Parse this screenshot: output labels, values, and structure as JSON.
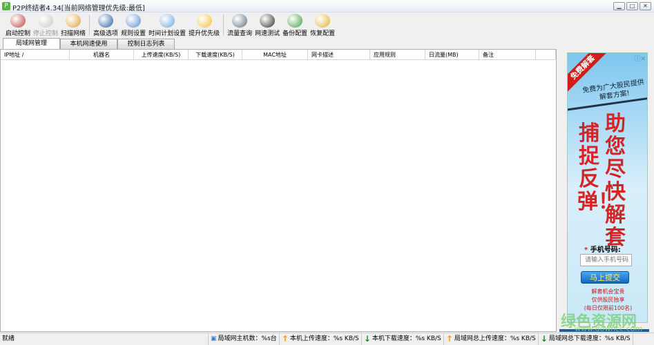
{
  "window": {
    "title": "P2P终结者4.34[当前网络管理优先级:最低]",
    "buttons": [
      "minimize",
      "maximize",
      "close"
    ]
  },
  "toolbar": [
    {
      "label": "启动控制",
      "icon": "rocket-icon",
      "color": "#c04040",
      "enabled": true
    },
    {
      "label": "停止控制",
      "icon": "stop-rocket-icon",
      "color": "#c8c8c8",
      "enabled": false
    },
    {
      "label": "扫描网络",
      "icon": "magnifier-icon",
      "color": "#e0a030",
      "enabled": true
    },
    {
      "label": "高级选项",
      "icon": "globe-gear-icon",
      "color": "#2a5fa0",
      "enabled": true
    },
    {
      "label": "规则设置",
      "icon": "window-key-icon",
      "color": "#5a8fd0",
      "enabled": true
    },
    {
      "label": "时间计划设置",
      "icon": "clock-icon",
      "color": "#6aa7e0",
      "enabled": true
    },
    {
      "label": "提升优先级",
      "icon": "medal-icon",
      "color": "#f0c030",
      "enabled": true
    },
    {
      "label": "流量查询",
      "icon": "database-icon",
      "color": "#607080",
      "enabled": true
    },
    {
      "label": "网速测试",
      "icon": "speedometer-icon",
      "color": "#303030",
      "enabled": true
    },
    {
      "label": "备份配置",
      "icon": "box-down-icon",
      "color": "#40a040",
      "enabled": true
    },
    {
      "label": "恢复配置",
      "icon": "box-refresh-icon",
      "color": "#e0b030",
      "enabled": true
    }
  ],
  "tabs": [
    {
      "label": "局域网管理",
      "active": true
    },
    {
      "label": "本机网速使用",
      "active": false
    },
    {
      "label": "控制日志列表",
      "active": false
    }
  ],
  "columns": [
    "IP地址  /",
    "机器名",
    "上传速度(KB/S)",
    "下载速度(KB/S)",
    "MAC地址",
    "网卡描述",
    "应用规则",
    "日流量(MB)",
    "备注",
    ""
  ],
  "ad": {
    "ribbon": "免费解套",
    "subtitle": "免费为广大股民提供解套方案!",
    "left_text": "捕捉反弹！",
    "right_text": "助您尽快解套",
    "phone_label": "手机号码:",
    "phone_placeholder": "请输入手机号码",
    "submit": "马上提交",
    "notes": [
      "解套机会宝贵",
      "仅供股民独享",
      "(每日仅限前100名)"
    ],
    "close": "ⓘ✕"
  },
  "watermark": {
    "text": "绿色资源网",
    "url": "www.downcc.com"
  },
  "status": {
    "ready": "就绪",
    "items": [
      {
        "icon": "network-hosts-icon",
        "text": "局域网主机数：%s台"
      },
      {
        "icon": "arrow-up-icon",
        "text": "本机上传速度：%s KB/S"
      },
      {
        "icon": "arrow-down-icon",
        "text": "本机下载速度：%s KB/S"
      },
      {
        "icon": "arrow-up-icon",
        "text": "局域网总上传速度：%s KB/S"
      },
      {
        "icon": "arrow-down-icon",
        "text": "局域网总下载速度：%s KB/S"
      }
    ]
  }
}
